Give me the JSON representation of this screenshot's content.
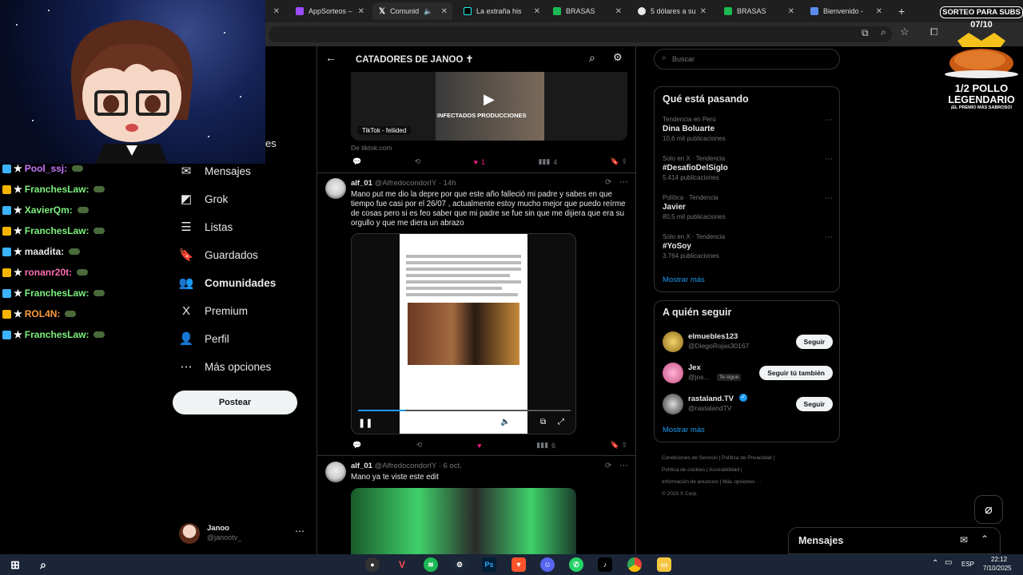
{
  "browser": {
    "tabs": [
      {
        "label": "AppSorteos –",
        "color": "#9b4dff"
      },
      {
        "label": "Comunid",
        "color": "#ffffff"
      },
      {
        "label": "La extraña his",
        "color": "#000000"
      },
      {
        "label": "BRASAS",
        "color": "#1db954"
      },
      {
        "label": "5 dólares a su",
        "color": "#e9e9e9"
      },
      {
        "label": "BRASAS",
        "color": "#1db954"
      },
      {
        "label": "Bienvenido -",
        "color": "#5b8def"
      }
    ],
    "new_tab": "+"
  },
  "overlay": {
    "sorteo_label": "SORTEO PARA SUBS",
    "sorteo_count": "07/10",
    "prize_line1": "1/2 POLLO",
    "prize_line2": "LEGENDARIO",
    "prize_tag": "¡EL PREMIO MÁS SABROSO!"
  },
  "stream_chat": [
    {
      "user": "Pool_ssj:",
      "color": "#c879ff"
    },
    {
      "user": "FranchesLaw:",
      "color": "#7cf07c"
    },
    {
      "user": "XavierQm:",
      "color": "#7cf07c"
    },
    {
      "user": "FranchesLaw:",
      "color": "#7cf07c"
    },
    {
      "user": "maadita:",
      "color": "#e6e6e6"
    },
    {
      "user": "ronanr20t:",
      "color": "#ff6fb0"
    },
    {
      "user": "FranchesLaw:",
      "color": "#7cf07c"
    },
    {
      "user": "ROL4N:",
      "color": "#ff9b3d"
    },
    {
      "user": "FranchesLaw:",
      "color": "#7cf07c"
    }
  ],
  "sidebar": {
    "partial_label": "es",
    "items": [
      {
        "label": "Mensajes",
        "icon": "✉",
        "active": false
      },
      {
        "label": "Grok",
        "icon": "◩",
        "active": false
      },
      {
        "label": "Listas",
        "icon": "☰",
        "active": false
      },
      {
        "label": "Guardados",
        "icon": "🔖",
        "active": false
      },
      {
        "label": "Comunidades",
        "icon": "👥",
        "active": true
      },
      {
        "label": "Premium",
        "icon": "X",
        "active": false
      },
      {
        "label": "Perfil",
        "icon": "👤",
        "active": false
      },
      {
        "label": "Más opciones",
        "icon": "⋯",
        "active": false
      }
    ],
    "post_button": "Postear",
    "account_name": "Janoo",
    "account_handle": "@janootv_"
  },
  "feed": {
    "title": "CATADORES DE JANOO ✝",
    "embed_source": "TikTok - feliided",
    "embed_caption": "INFECTADOS PRODUCCIONES",
    "embed_domain": "De tiktok.com",
    "post1_likes": "1",
    "post1_views": "4",
    "tweet1": {
      "name": "alf_01",
      "handle": "@AlfredocondorIY",
      "time": "· 14h",
      "text": "Mano put me dio la depre por que este año falleció mi padre y sabes en que tiempo fue casi por el 26/07 , actualmente estoy mucho mejor que puedo reírme de cosas pero si es feo saber que mi padre se fue sin que me dijiera que era su orgullo y que me diera un abrazo",
      "video_time": "0:06 / 0:28",
      "views": "6"
    },
    "tweet2": {
      "name": "alf_01",
      "handle": "@AlfredocondorIY",
      "time": "· 6 oct.",
      "text": "Mano ya te viste este edit"
    }
  },
  "right": {
    "search_placeholder": "Buscar",
    "trends_title": "Qué está pasando",
    "trends": [
      {
        "meta": "Tendencia en Perú",
        "name": "Dina Boluarte",
        "count": "10,6 mil publicaciones"
      },
      {
        "meta": "Solo en X · Tendencia",
        "name": "#DesafioDelSiglo",
        "count": "5.414 publicaciones"
      },
      {
        "meta": "Política · Tendencia",
        "name": "Javier",
        "count": "80,5 mil publicaciones"
      },
      {
        "meta": "Solo en X · Tendencia",
        "name": "#YoSoy",
        "count": "3.764 publicaciones"
      }
    ],
    "show_more": "Mostrar más",
    "who_title": "A quién seguir",
    "who": [
      {
        "name": "elmuebles123",
        "handle": "@DiegoRojas30167",
        "button": "Seguir",
        "tag": ""
      },
      {
        "name": "Jex",
        "handle": "@jos...",
        "button": "Seguir tú también",
        "tag": "Te sigue"
      },
      {
        "name": "rastaland.TV",
        "handle": "@rastalandTV",
        "button": "Seguir",
        "tag": ""
      }
    ],
    "footer_links": [
      "Condiciones de Servicio",
      "Política de Privacidad",
      "Política de cookies",
      "Accesibilidad",
      "Información de anuncios",
      "Más opciones ···"
    ],
    "copyright": "© 2025 X Corp.",
    "messages_label": "Mensajes"
  },
  "taskbar": {
    "lang": "ESP",
    "time": "22:12",
    "date": "7/10/2025"
  },
  "colors": {
    "like": "#f91880",
    "link": "#1d9bf0",
    "bg": "#000000",
    "border": "#2f3336"
  }
}
